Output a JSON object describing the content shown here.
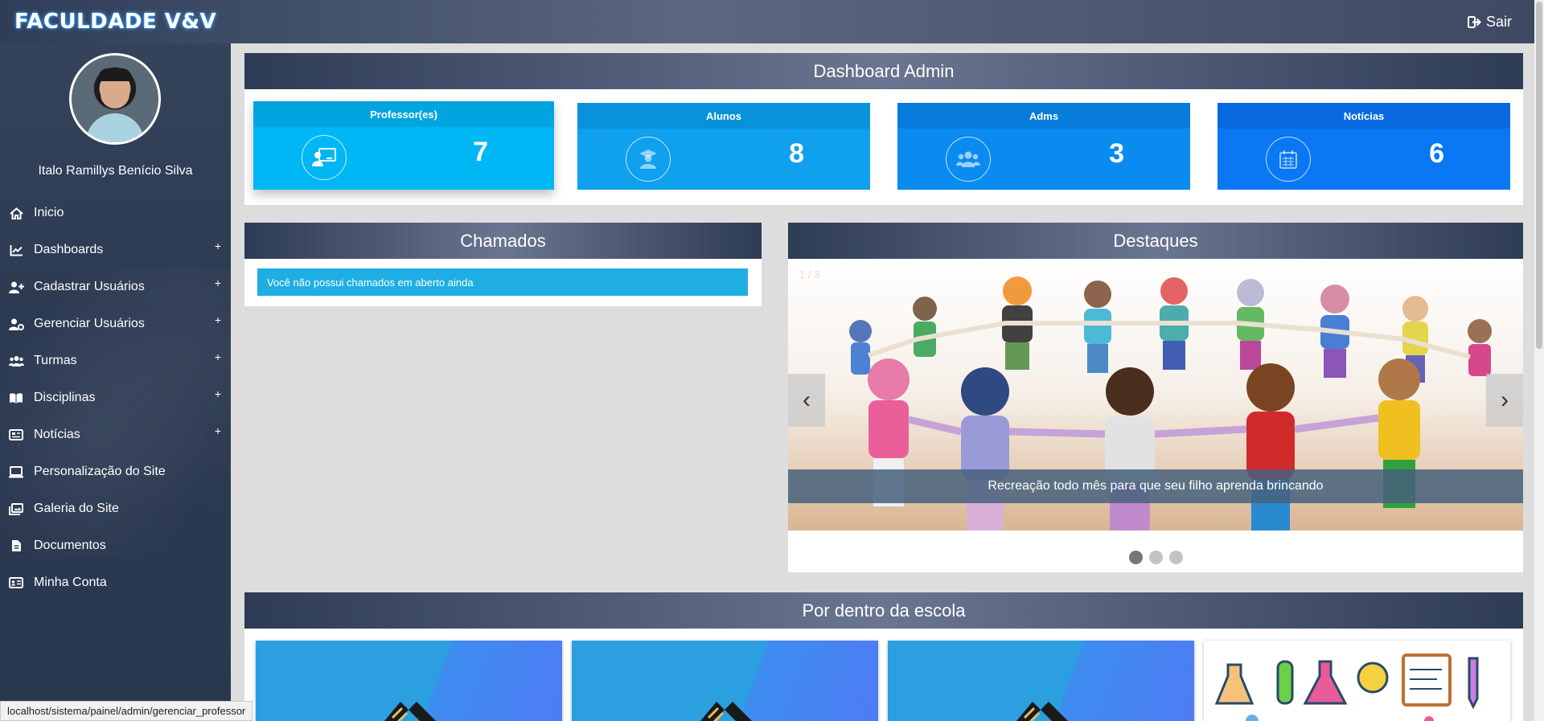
{
  "app": {
    "brand": "FACULDADE V&V",
    "logout_label": "Sair"
  },
  "user": {
    "name": "Italo Ramillys Benício Silva"
  },
  "sidebar": {
    "items": [
      {
        "label": "Inicio",
        "icon": "home-icon",
        "expandable": false
      },
      {
        "label": "Dashboards",
        "icon": "chart-line-icon",
        "expandable": true
      },
      {
        "label": "Cadastrar Usuários",
        "icon": "user-plus-icon",
        "expandable": true
      },
      {
        "label": "Gerenciar Usuários",
        "icon": "user-gear-icon",
        "expandable": true
      },
      {
        "label": "Turmas",
        "icon": "users-icon",
        "expandable": true
      },
      {
        "label": "Disciplinas",
        "icon": "book-icon",
        "expandable": true
      },
      {
        "label": "Notícias",
        "icon": "newspaper-icon",
        "expandable": true
      },
      {
        "label": "Personalização do Site",
        "icon": "laptop-icon",
        "expandable": false
      },
      {
        "label": "Galeria do Site",
        "icon": "images-icon",
        "expandable": false
      },
      {
        "label": "Documentos",
        "icon": "file-icon",
        "expandable": false
      },
      {
        "label": "Minha Conta",
        "icon": "id-card-icon",
        "expandable": false
      }
    ],
    "expand_symbol": "+"
  },
  "dashboard": {
    "title": "Dashboard Admin",
    "stats": [
      {
        "label": "Professor(es)",
        "value": "7",
        "icon": "chalkboard-teacher-icon",
        "color": "#00b7f5"
      },
      {
        "label": "Alunos",
        "value": "8",
        "icon": "graduate-icon",
        "color": "#0fa0ee"
      },
      {
        "label": "Adms",
        "value": "3",
        "icon": "users-group-icon",
        "color": "#0a8bf0"
      },
      {
        "label": "Notícias",
        "value": "6",
        "icon": "calendar-icon",
        "color": "#0a78f5"
      }
    ]
  },
  "chamados": {
    "title": "Chamados",
    "message": "Você não possui chamados em aberto ainda"
  },
  "destaques": {
    "title": "Destaques",
    "counter": "1 / 3",
    "caption": "Recreação todo mês para que seu filho aprenda brincando",
    "prev_label": "‹",
    "next_label": "›",
    "slides_total": 3,
    "active_slide": 1
  },
  "escola": {
    "title": "Por dentro da escola"
  },
  "status_url": "localhost/sistema/painel/admin/gerenciar_professor"
}
